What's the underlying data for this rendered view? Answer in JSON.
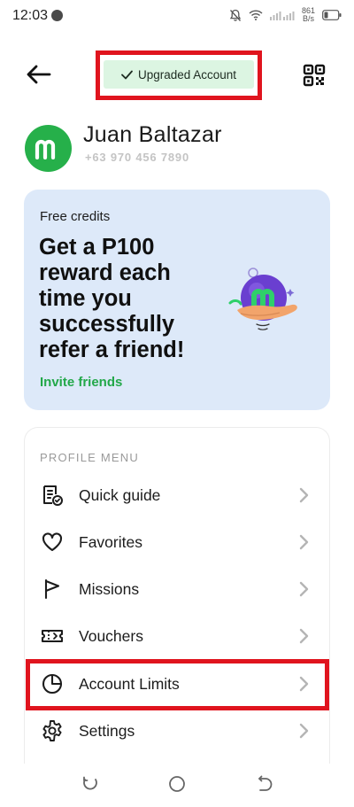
{
  "status_bar": {
    "time": "12:03",
    "speed_value": "861",
    "speed_unit": "B/s"
  },
  "header": {
    "badge_label": "Upgraded Account"
  },
  "profile": {
    "name": "Juan Baltazar",
    "phone": "+63 970 456 7890",
    "avatar_letter": "m"
  },
  "promo": {
    "kicker": "Free credits",
    "headline": "Get a P100 reward each time you successfully refer a friend!",
    "link": "Invite friends"
  },
  "menu": {
    "heading": "PROFILE MENU",
    "items": [
      {
        "label": "Quick guide",
        "icon": "guide-icon"
      },
      {
        "label": "Favorites",
        "icon": "heart-icon"
      },
      {
        "label": "Missions",
        "icon": "flag-icon"
      },
      {
        "label": "Vouchers",
        "icon": "ticket-icon"
      },
      {
        "label": "Account Limits",
        "icon": "pie-chart-icon"
      },
      {
        "label": "Settings",
        "icon": "gear-icon"
      }
    ]
  },
  "colors": {
    "brand_green": "#26b04a",
    "highlight_red": "#e0141e",
    "promo_bg": "#dde9f9",
    "badge_bg": "#dcf5e2"
  }
}
